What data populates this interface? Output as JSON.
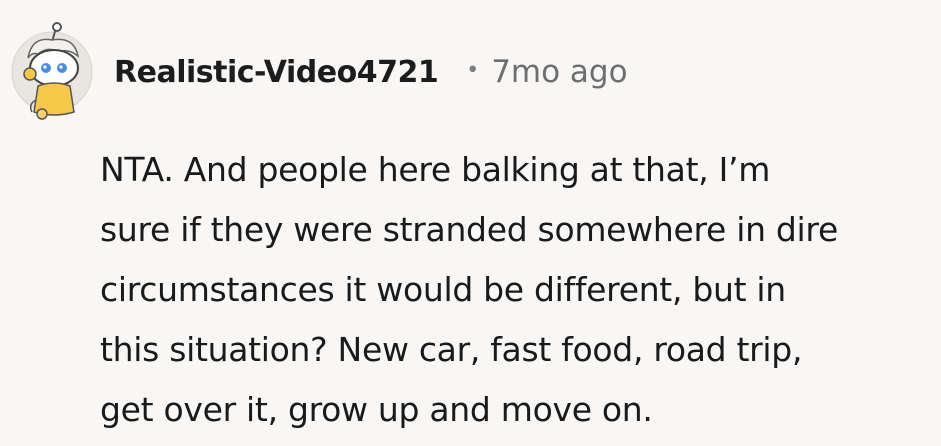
{
  "comment": {
    "author": "Realistic-Video4721",
    "separator": "•",
    "time": "7mo ago",
    "body_lines": [
      "NTA. And people here balking at that, I’m",
      "sure if they were stranded somewhere in dire",
      "circumstances it would be different, but in",
      "this situation? New car, fast food, road trip,",
      "get over it, grow up and move on."
    ]
  },
  "colors": {
    "background": "#f8f7f6",
    "author": "#1c1c1c",
    "meta": "#6e6e6e",
    "avatar_accent": "#f5c84a"
  },
  "icons": {
    "avatar": "snoo-avatar"
  }
}
